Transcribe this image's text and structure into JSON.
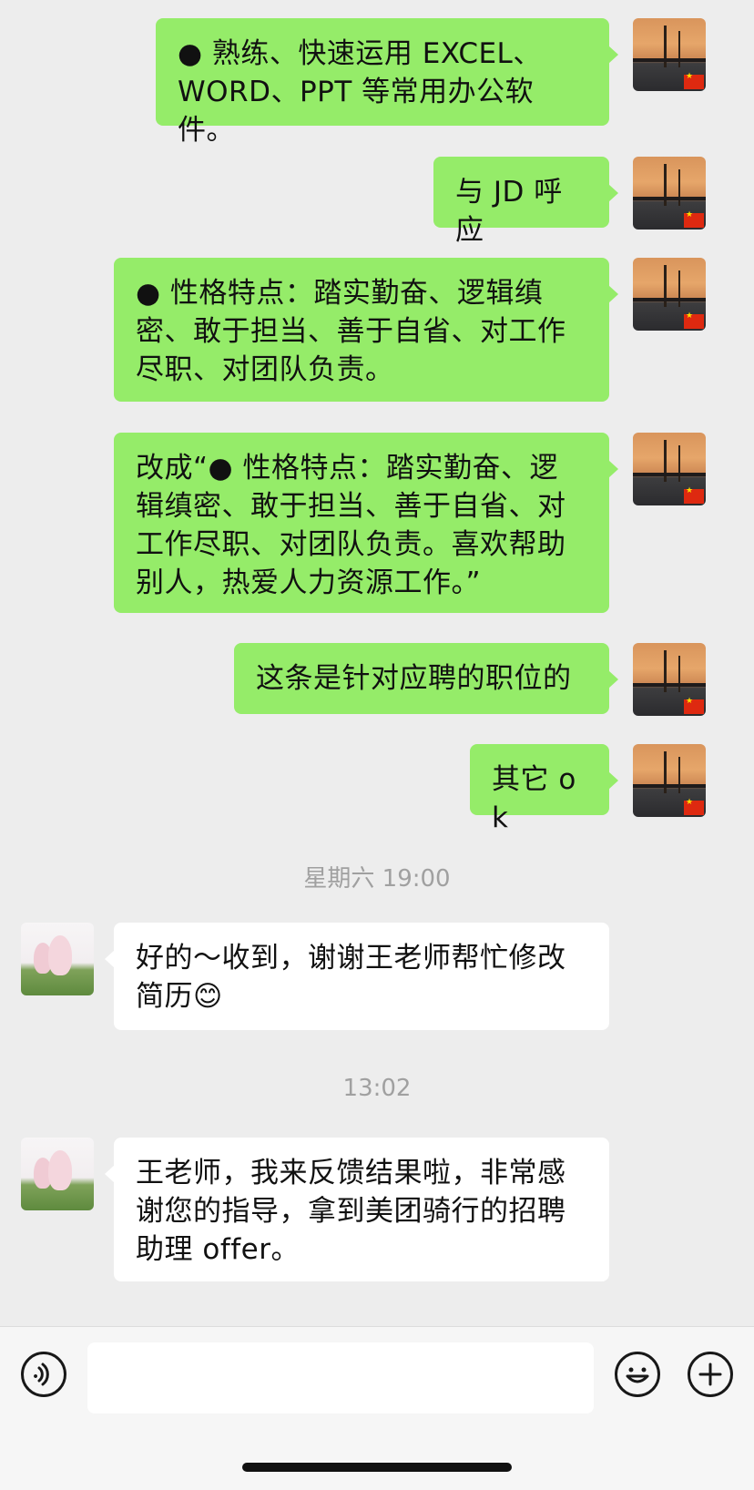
{
  "messages": [
    {
      "id": "m1",
      "side": "out",
      "text": "● 熟练、快速运用 EXCEL、\nWORD、PPT 等常用办公软件。"
    },
    {
      "id": "m2",
      "side": "out",
      "text": "与 JD 呼应"
    },
    {
      "id": "m3",
      "side": "out",
      "text": "● 性格特点：踏实勤奋、逻辑缜\n密、敢于担当、善于自省、对工作\n尽职、对团队负责。"
    },
    {
      "id": "m4",
      "side": "out",
      "text": "改成“● 性格特点：踏实勤奋、逻\n辑缜密、敢于担当、善于自省、对\n工作尽职、对团队负责。喜欢帮助\n别人，热爱人力资源工作。”"
    },
    {
      "id": "m5",
      "side": "out",
      "text": "这条是针对应聘的职位的"
    },
    {
      "id": "m6",
      "side": "out",
      "text": "其它 ok"
    },
    {
      "id": "m7",
      "side": "in",
      "text": "好的～收到，谢谢王老师帮忙修改\n简历😊"
    },
    {
      "id": "m8",
      "side": "in",
      "text": "王老师，我来反馈结果啦，非常感\n谢您的指导，拿到美团骑行的招聘\n助理 offer。"
    }
  ],
  "timestamps": {
    "t1": "星期六 19:00",
    "t2": "13:02"
  },
  "input_bar": {
    "placeholder": "",
    "voice_icon": "voice-icon",
    "emoji_icon": "emoji-icon",
    "plus_icon": "plus-icon"
  },
  "colors": {
    "outgoing_bubble": "#95ec69",
    "incoming_bubble": "#ffffff",
    "background": "#ededed"
  }
}
